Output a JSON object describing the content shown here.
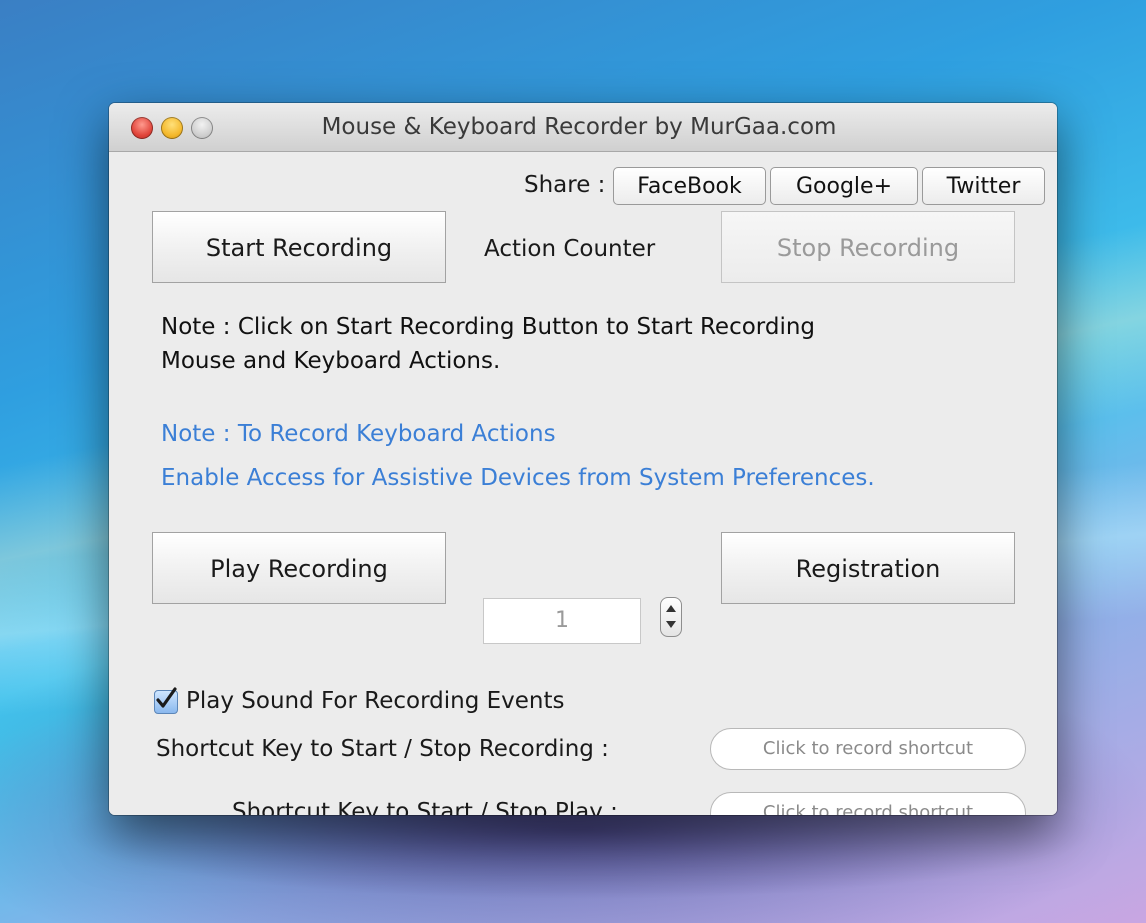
{
  "window": {
    "title": "Mouse & Keyboard Recorder by MurGaa.com"
  },
  "share": {
    "label": "Share :",
    "facebook": "FaceBook",
    "google": "Google+",
    "twitter": "Twitter"
  },
  "recording": {
    "start_label": "Start Recording",
    "counter_label": "Action Counter",
    "stop_label": "Stop Recording",
    "stop_enabled": false
  },
  "notes": {
    "line1": "Note : Click on Start Recording Button to Start Recording",
    "line2": "Mouse and Keyboard Actions.",
    "keyboard_line1": "Note : To Record Keyboard Actions",
    "keyboard_line2": "Enable Access for Assistive Devices from System Preferences."
  },
  "playback": {
    "play_label": "Play Recording",
    "repeat_count": "1",
    "registration_label": "Registration"
  },
  "options": {
    "play_sound_label": "Play Sound For Recording Events",
    "play_sound_checked": true
  },
  "shortcuts": {
    "record_label": "Shortcut Key to Start / Stop Recording :",
    "record_placeholder": "Click to record shortcut",
    "play_label": "Shortcut Key to Start / Stop Play  :",
    "play_placeholder": "Click to record shortcut"
  },
  "colors": {
    "note_blue": "#3b7fd6",
    "window_bg": "#ececec",
    "close": "#e0443a",
    "minimize": "#f4b82c"
  }
}
